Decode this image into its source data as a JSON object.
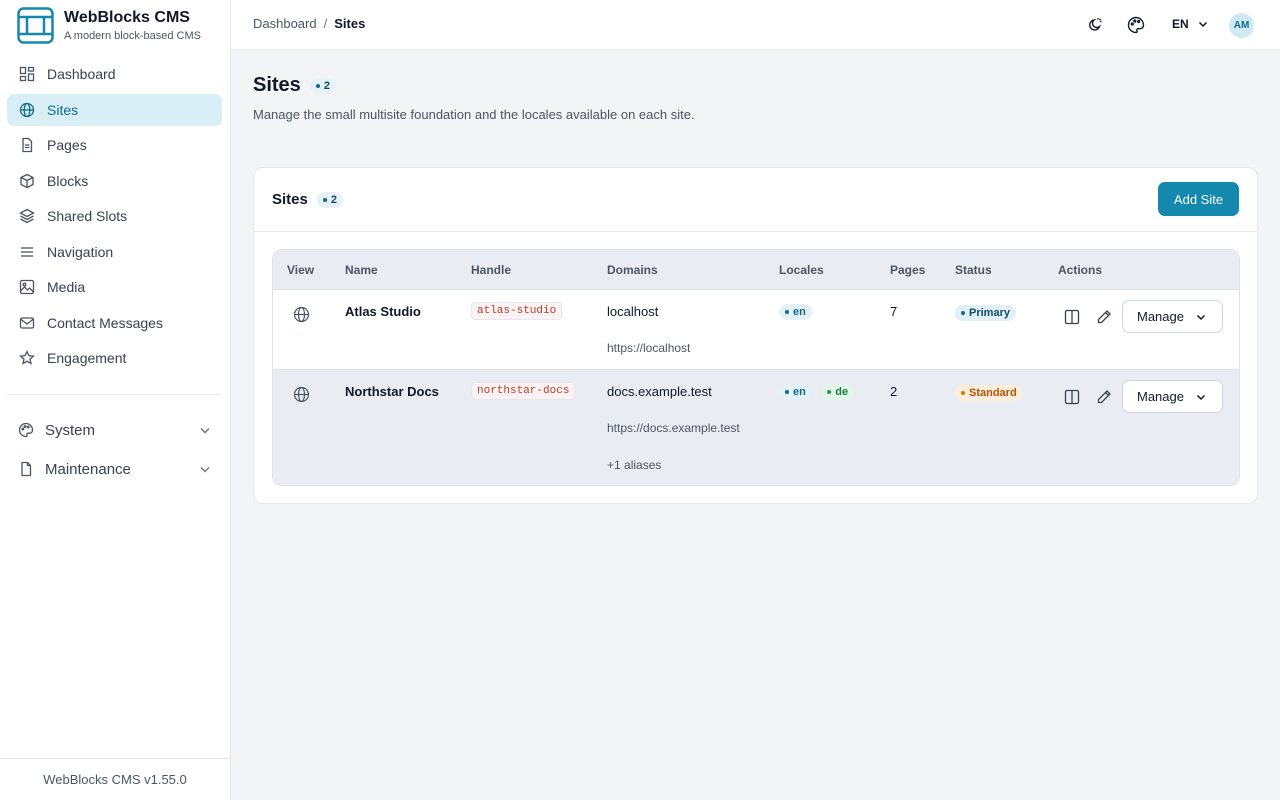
{
  "brand": {
    "name": "WebBlocks CMS",
    "tagline": "A modern block-based CMS"
  },
  "sidebar": {
    "items": [
      {
        "label": "Dashboard",
        "icon": "dashboard-icon",
        "active": false
      },
      {
        "label": "Sites",
        "icon": "globe-icon",
        "active": true
      },
      {
        "label": "Pages",
        "icon": "document-icon",
        "active": false
      },
      {
        "label": "Blocks",
        "icon": "cube-icon",
        "active": false
      },
      {
        "label": "Shared Slots",
        "icon": "layers-icon",
        "active": false
      },
      {
        "label": "Navigation",
        "icon": "menu-icon",
        "active": false
      },
      {
        "label": "Media",
        "icon": "image-icon",
        "active": false
      },
      {
        "label": "Contact Messages",
        "icon": "mail-icon",
        "active": false
      },
      {
        "label": "Engagement",
        "icon": "star-icon",
        "active": false
      }
    ],
    "groups": [
      {
        "label": "System",
        "icon": "palette-icon"
      },
      {
        "label": "Maintenance",
        "icon": "file-icon"
      }
    ],
    "footer": "WebBlocks CMS v1.55.0"
  },
  "header": {
    "breadcrumb": {
      "root": "Dashboard",
      "separator": "/",
      "current": "Sites"
    },
    "language": "EN",
    "avatar_initials": "AM"
  },
  "page": {
    "title": "Sites",
    "count": "2",
    "subtitle": "Manage the small multisite foundation and the locales available on each site."
  },
  "card": {
    "title": "Sites",
    "count": "2",
    "add_label": "Add Site"
  },
  "table": {
    "headers": {
      "view": "View",
      "name": "Name",
      "handle": "Handle",
      "domains": "Domains",
      "locales": "Locales",
      "pages": "Pages",
      "status": "Status",
      "actions": "Actions"
    },
    "rows": [
      {
        "name": "Atlas Studio",
        "handle": "atlas-studio",
        "domain": "localhost",
        "url": "https://localhost",
        "aliases": "",
        "locales": [
          "en"
        ],
        "pages": "7",
        "status": "Primary",
        "manage_label": "Manage"
      },
      {
        "name": "Northstar Docs",
        "handle": "northstar-docs",
        "domain": "docs.example.test",
        "url": "https://docs.example.test",
        "aliases": "+1 aliases",
        "locales": [
          "en",
          "de"
        ],
        "pages": "2",
        "status": "Standard",
        "manage_label": "Manage"
      }
    ]
  },
  "colors": {
    "accent": "#1489ad",
    "active_nav_bg": "#d9eff6",
    "primary_status": "#0f6b8a",
    "standard_status": "#d97706",
    "locale_de": "#16a34a"
  }
}
